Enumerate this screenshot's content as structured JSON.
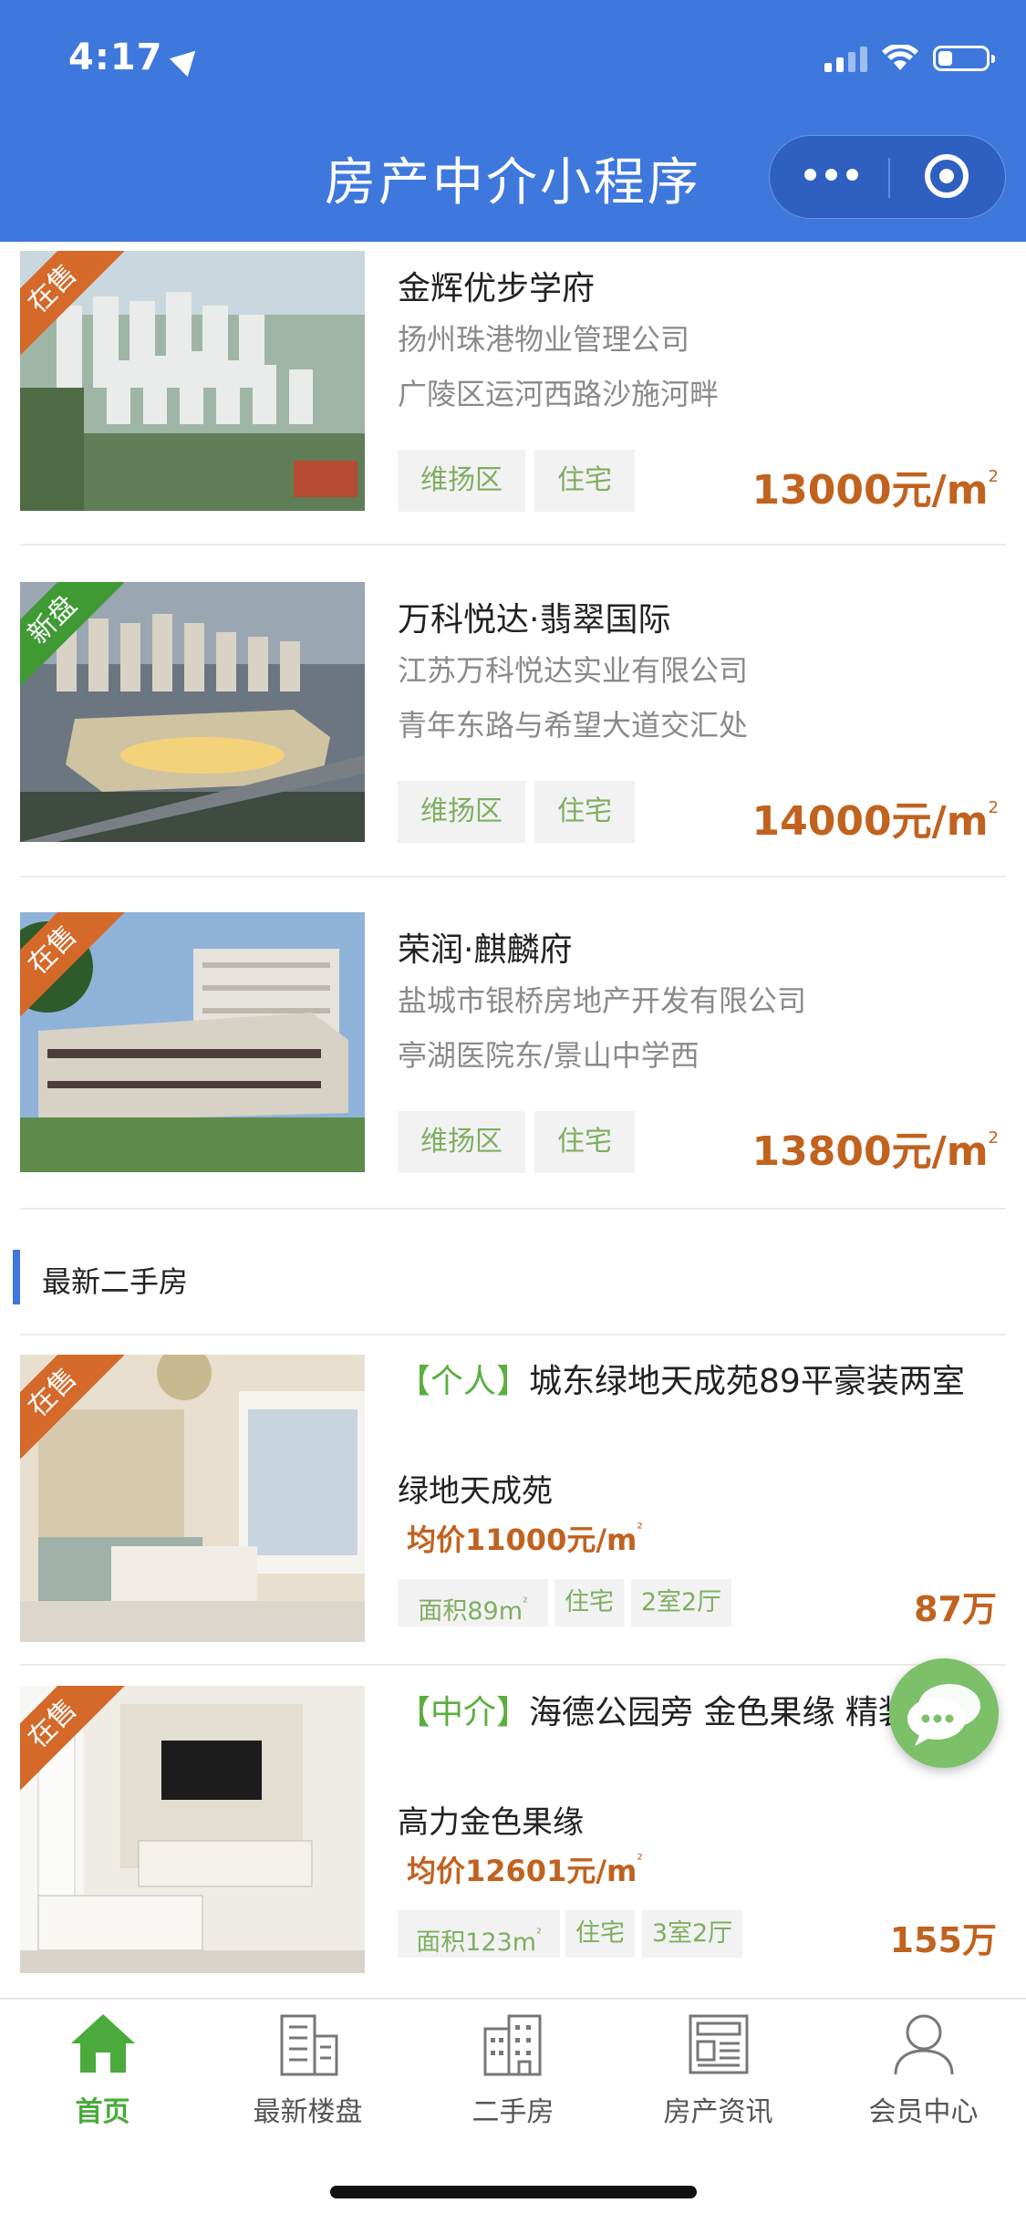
{
  "status_bar": {
    "time": "4:17",
    "battery_level": 0.3
  },
  "nav": {
    "title": "房产中介小程序"
  },
  "new_listings": [
    {
      "ribbon": "在售",
      "ribbon_color": "#d4692a",
      "title": "金辉优步学府",
      "developer": "扬州珠港物业管理公司",
      "address": "广陵区运河西路沙施河畔",
      "tags": [
        "维扬区",
        "住宅"
      ],
      "price": "13000元/m",
      "price_sup": "2"
    },
    {
      "ribbon": "新盘",
      "ribbon_color": "#3f9a34",
      "title": "万科悦达·翡翠国际",
      "developer": "江苏万科悦达实业有限公司",
      "address": "青年东路与希望大道交汇处",
      "tags": [
        "维扬区",
        "住宅"
      ],
      "price": "14000元/m",
      "price_sup": "2"
    },
    {
      "ribbon": "在售",
      "ribbon_color": "#d4692a",
      "title": "荣润·麒麟府",
      "developer": "盐城市银桥房地产开发有限公司",
      "address": "亭湖医院东/景山中学西",
      "tags": [
        "维扬区",
        "住宅"
      ],
      "price": "13800元/m",
      "price_sup": "2"
    }
  ],
  "second_hand": {
    "section_title": "最新二手房",
    "items": [
      {
        "ribbon": "在售",
        "ribbon_color": "#d4692a",
        "kind": "【个人】",
        "title": "城东绿地天成苑89平豪装两室",
        "community": "绿地天成苑",
        "avg_price": "均价11000元/m",
        "avg_sup": "²",
        "area": "面积89m",
        "area_sup": "²",
        "type": "住宅",
        "layout": "2室2厅",
        "price": "87万"
      },
      {
        "ribbon": "在售",
        "ribbon_color": "#d4692a",
        "kind": "【中介】",
        "title": "海德公园旁 金色果缘 精装3房",
        "community": "高力金色果缘",
        "avg_price": "均价12601元/m",
        "avg_sup": "²",
        "area": "面积123m",
        "area_sup": "²",
        "type": "住宅",
        "layout": "3室2厅",
        "price": "155万"
      }
    ]
  },
  "tabbar": {
    "items": [
      {
        "label": "首页",
        "icon": "home-icon",
        "active": true
      },
      {
        "label": "最新楼盘",
        "icon": "building-icon",
        "active": false
      },
      {
        "label": "二手房",
        "icon": "apartment-icon",
        "active": false
      },
      {
        "label": "房产资讯",
        "icon": "news-icon",
        "active": false
      },
      {
        "label": "会员中心",
        "icon": "user-icon",
        "active": false
      }
    ]
  },
  "colors": {
    "primary": "#3f78dd",
    "price": "#c1621f",
    "green": "#4aaa3c"
  }
}
